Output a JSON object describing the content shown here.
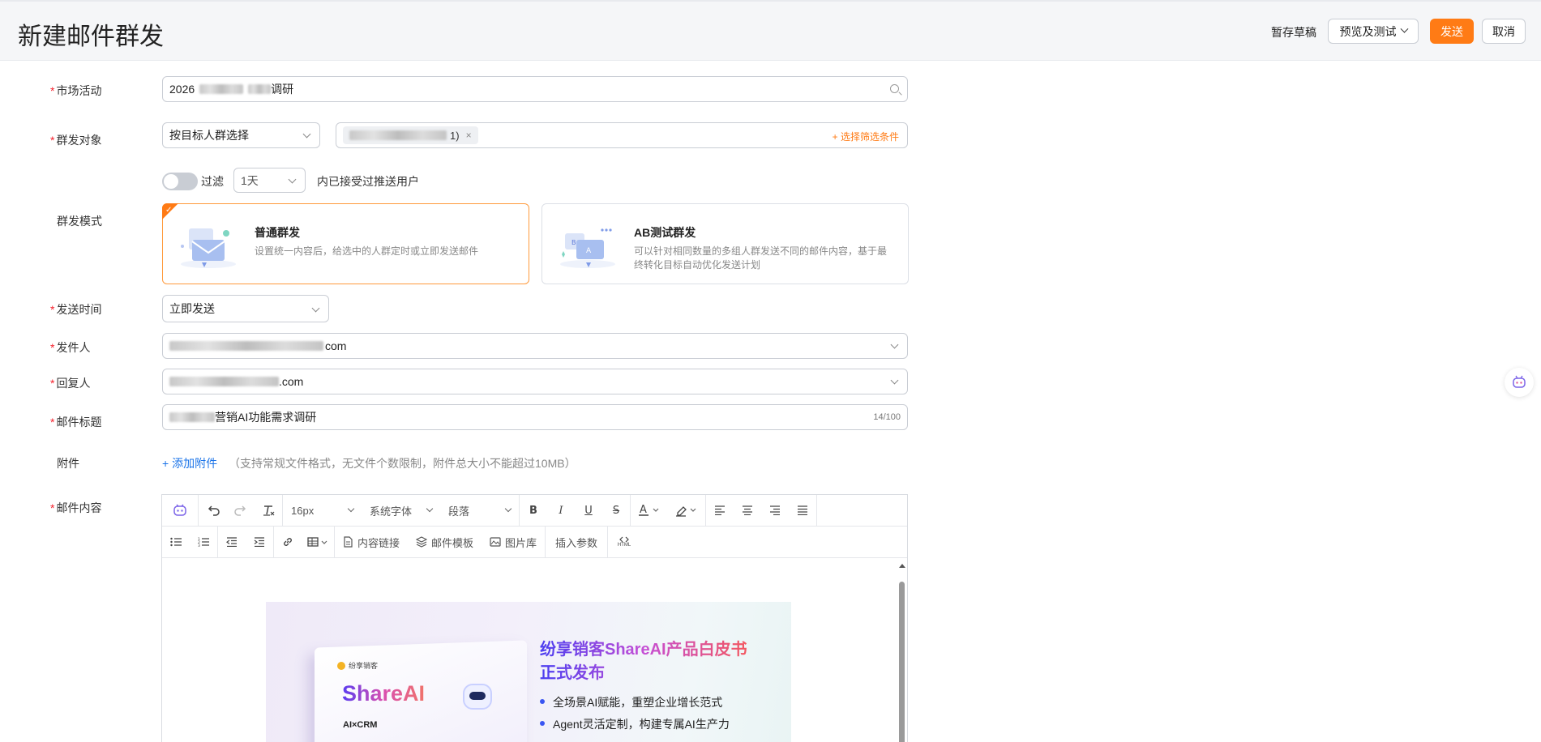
{
  "header": {
    "title": "新建邮件群发",
    "draft_label": "暂存草稿",
    "preview_label": "预览及测试",
    "send_label": "发送",
    "cancel_label": "取消"
  },
  "form": {
    "campaign": {
      "label": "市场活动",
      "value_prefix": "2026",
      "value_suffix": "调研"
    },
    "audience": {
      "label": "群发对象",
      "mode_value": "按目标人群选择",
      "tag_suffix": "1)",
      "tag_close": "×",
      "filter_link": "+ 选择筛选条件"
    },
    "filter": {
      "label": "过滤",
      "period": "1天",
      "suffix": "内已接受过推送用户"
    },
    "send_mode": {
      "label": "群发模式",
      "normal_title": "普通群发",
      "normal_desc": "设置统一内容后，给选中的人群定时或立即发送邮件",
      "ab_title": "AB测试群发",
      "ab_desc": "可以针对相同数量的多组人群发送不同的邮件内容，基于最终转化目标自动优化发送计划"
    },
    "send_time": {
      "label": "发送时间",
      "value": "立即发送"
    },
    "sender": {
      "label": "发件人",
      "value_suffix": "com"
    },
    "reply_to": {
      "label": "回复人",
      "value_suffix": ".com"
    },
    "subject": {
      "label": "邮件标题",
      "value_suffix": "营销AI功能需求调研",
      "counter": "14/100"
    },
    "attachment": {
      "label": "附件",
      "link": "+ 添加附件",
      "hint": "（支持常规文件格式，无文件个数限制，附件总大小不能超过10MB）"
    },
    "content": {
      "label": "邮件内容"
    }
  },
  "editor": {
    "font_size": "16px",
    "font_family": "系统字体",
    "paragraph": "段落",
    "content_link": "内容链接",
    "mail_template": "邮件模板",
    "image_library": "图片库",
    "insert_param": "插入参数",
    "html_label": "HTML"
  },
  "banner": {
    "brand": "纷享销客",
    "logo": "ShareAI",
    "product_line": "AI×CRM",
    "title_line1": "纷享销客ShareAI产品白皮书",
    "title_line2": "正式发布",
    "bullets": [
      "全场景AI赋能，重塑企业增长范式",
      "Agent灵活定制，构建专属AI生产力"
    ]
  },
  "colors": {
    "accent": "#ff7b15",
    "link": "#1a73e8",
    "required": "#f5222d"
  }
}
